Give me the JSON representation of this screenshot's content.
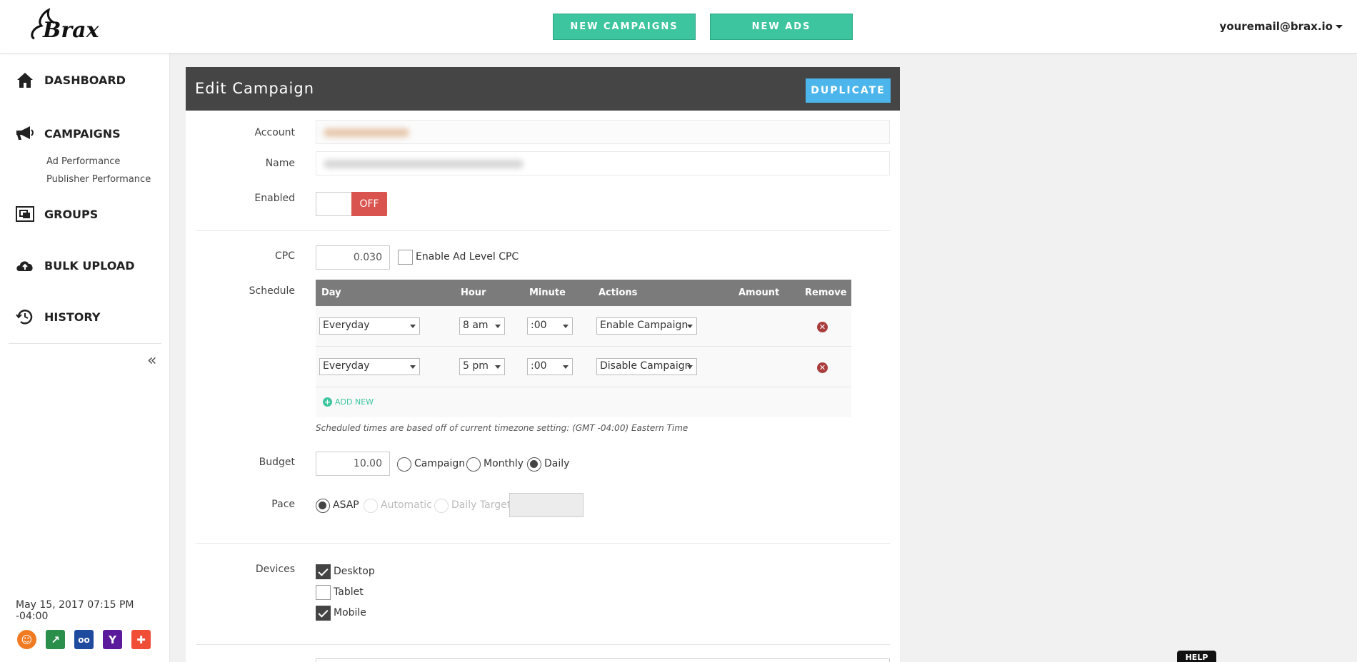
{
  "header": {
    "logo_text": "Brax",
    "new_campaigns": "NEW CAMPAIGNS",
    "new_ads": "NEW ADS",
    "user_email": "youremail@brax.io"
  },
  "sidebar": {
    "items": [
      {
        "label": "DASHBOARD",
        "icon": "home-icon"
      },
      {
        "label": "CAMPAIGNS",
        "icon": "megaphone-icon"
      },
      {
        "label": "GROUPS",
        "icon": "groups-icon"
      },
      {
        "label": "BULK UPLOAD",
        "icon": "cloud-upload-icon"
      },
      {
        "label": "HISTORY",
        "icon": "history-icon"
      }
    ],
    "sub_items": [
      "Ad Performance",
      "Publisher Performance"
    ],
    "collapse": "«",
    "datetime": "May 15, 2017 07:15 PM -04:00",
    "publishers": [
      {
        "icon": "outbrain-icon",
        "glyph": "☺",
        "color": "#f07b22"
      },
      {
        "icon": "revcontent-icon",
        "glyph": "↗",
        "color": "#2a8f4b"
      },
      {
        "icon": "taboola-icon",
        "glyph": "oo",
        "color": "#1f4b9e"
      },
      {
        "icon": "yahoo-icon",
        "glyph": "Y",
        "color": "#5b1a9b"
      },
      {
        "icon": "contentad-icon",
        "glyph": "✚",
        "color": "#f04e37"
      }
    ]
  },
  "panel": {
    "title": "Edit Campaign",
    "duplicate": "DUPLICATE",
    "labels": {
      "account": "Account",
      "name": "Name",
      "enabled": "Enabled",
      "cpc": "CPC",
      "schedule": "Schedule",
      "budget": "Budget",
      "pace": "Pace",
      "devices": "Devices"
    },
    "enabled_state": "OFF",
    "cpc_value": "0.030",
    "enable_ad_level_cpc": "Enable Ad Level CPC",
    "schedule": {
      "headers": [
        "Day",
        "Hour",
        "Minute",
        "Actions",
        "Amount",
        "Remove"
      ],
      "rows": [
        {
          "day": "Everyday",
          "hour": "8 am",
          "minute": ":00",
          "action": "Enable Campaign"
        },
        {
          "day": "Everyday",
          "hour": "5 pm",
          "minute": ":00",
          "action": "Disable Campaign"
        }
      ],
      "add_new": "ADD NEW",
      "note": "Scheduled times are based off of current timezone setting: (GMT -04:00) Eastern Time"
    },
    "budget_value": "10.00",
    "budget_options": [
      "Campaign",
      "Monthly",
      "Daily"
    ],
    "pace_options": [
      "ASAP",
      "Automatic",
      "Daily Target"
    ],
    "devices": [
      {
        "label": "Desktop",
        "checked": true
      },
      {
        "label": "Tablet",
        "checked": false
      },
      {
        "label": "Mobile",
        "checked": true
      }
    ]
  },
  "help_label": "HELP"
}
